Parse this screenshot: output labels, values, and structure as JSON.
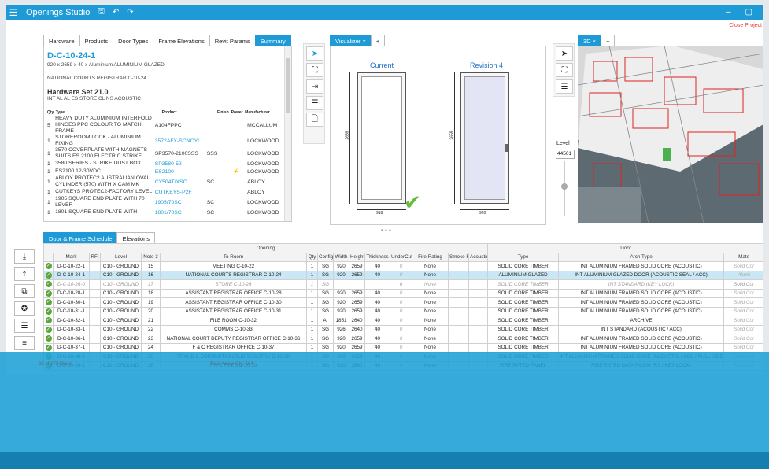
{
  "window": {
    "title": "Openings Studio",
    "close_project": "Close Project"
  },
  "tabs_top": [
    "Hardware",
    "Products",
    "Door Types",
    "Frame Elevations",
    "Revit Params",
    "Summary"
  ],
  "summary": {
    "door_id": "D-C-10-24-1",
    "spec": "920 x 2659 x 40 x Aluminium ALUMINIUM GLAZED",
    "location": "NATIONAL COURTS REGISTRAR C-10-24",
    "hardware_set": "Hardware Set 21.0",
    "hardware_sub": "INT AL AL ES STORE CL NS ACOUSTIC",
    "columns": [
      "Qty",
      "Type",
      "Product",
      "Finish",
      "Power",
      "Manufacturer"
    ],
    "rows": [
      {
        "qty": "5",
        "type": "HEAVY DUTY ALUMINIUM INTERFOLD HINGES PPC COLOUR TO MATCH FRAME",
        "product": "A104FPPC",
        "finish": "",
        "power": "",
        "mfr": "MCCALLUM"
      },
      {
        "qty": "1",
        "type": "STOREROOM LOCK - ALUMINIUM FIXING",
        "product": "3572AFX-SCNCYL",
        "finish": "",
        "power": "",
        "mfr": "LOCKWOOD"
      },
      {
        "qty": "1",
        "type": "3570 COVERPLATE WITH MAGNETS SUITS ES 2100 ELECTRIC STRIKE",
        "product": "SP3570-2100SSS",
        "finish": "SSS",
        "power": "",
        "mfr": "LOCKWOOD"
      },
      {
        "qty": "1",
        "type": "3580 SERIES - STRIKE DUST BOX",
        "product": "SP3580-52",
        "finish": "",
        "power": "",
        "mfr": "LOCKWOOD"
      },
      {
        "qty": "1",
        "type": "ES2100 12-30VDC",
        "product": "ES2100",
        "finish": "",
        "power": "⚡",
        "mfr": "LOCKWOOD"
      },
      {
        "qty": "1",
        "type": "ABLOY PROTEC2 AUSTRALIAN OVAL CYLINDER (570) WITH X CAM MK",
        "product": "CY504T/XSC",
        "finish": "SC",
        "power": "",
        "mfr": "ABLOY"
      },
      {
        "qty": "1",
        "type": "CUTKEYS PROTEC2-FACTORY LEVEL",
        "product": "CUTKEYS-P2F",
        "finish": "",
        "power": "",
        "mfr": "ABLOY"
      },
      {
        "qty": "1",
        "type": "1905 SQUARE END PLATE WITH 70 LEVER",
        "product": "1905/70SC",
        "finish": "SC",
        "power": "",
        "mfr": "LOCKWOOD"
      },
      {
        "qty": "1",
        "type": "1801 SQUARE END PLATE WITH",
        "product": "1801/70SC",
        "finish": "SC",
        "power": "",
        "mfr": "LOCKWOOD"
      }
    ]
  },
  "visualizer": {
    "tab": "Visualizer",
    "current": "Current",
    "revision": "Revision 4",
    "dim_h1": "2659",
    "dim_h2": "2659",
    "dim_w1": "918",
    "dim_w2": "920"
  },
  "view3d": {
    "tab": "3D",
    "level_label": "Level",
    "level_value": "44501"
  },
  "tabs_bottom": [
    "Door & Frame Schedule",
    "Elevations"
  ],
  "schedule": {
    "group_opening": "Opening",
    "group_door": "Door",
    "headers": [
      "Mark",
      "RFI",
      "Level",
      "Note 3",
      "To Room",
      "Qty",
      "Config",
      "Width",
      "Height",
      "Thickness",
      "UnderCut",
      "Fire Rating",
      "Smoke Rating",
      "Acoustic Rating",
      "Type",
      "Arch Type",
      "Mate"
    ],
    "rows": [
      {
        "mark": "D-C-10-22-1",
        "level": "C10 - GROUND",
        "note": "15",
        "room": "MEETING C-10-22",
        "qty": "1",
        "config": "SG",
        "width": "920",
        "height": "2659",
        "thick": "40",
        "uc": "0",
        "fire": "None",
        "type": "SOLID CORE TIMBER",
        "arch": "INT ALUMINIUM FRAMED SOLID CORE (ACOUSTIC)",
        "mat": "Solid Cor",
        "state": ""
      },
      {
        "mark": "D-C-10-24-1",
        "level": "C10 - GROUND",
        "note": "16",
        "room": "NATIONAL COURTS REGISTRAR C-10-24",
        "qty": "1",
        "config": "SG",
        "width": "920",
        "height": "2659",
        "thick": "40",
        "uc": "0",
        "fire": "None",
        "type": "ALUMINIUM GLAZED",
        "arch": "INT ALUMINIUM GLAZED DOOR (ACOUSTIC SEAL / ACC)",
        "mat": "Alumi",
        "state": "sel"
      },
      {
        "mark": "D-C-10-26-0",
        "level": "C10 - GROUND",
        "note": "17",
        "room": "STORE C-10-26",
        "qty": "1",
        "config": "SG",
        "width": "",
        "height": "",
        "thick": "",
        "uc": "0",
        "fire": "None",
        "type": "SOLID CORE TIMBER",
        "arch": "INT STANDARD (KEY LOCK)",
        "mat": "Solid Cor",
        "state": "dis"
      },
      {
        "mark": "D-C-10-28-1",
        "level": "C10 - GROUND",
        "note": "18",
        "room": "ASSISTANT REGISTRAR OFFICE C-10-28",
        "qty": "1",
        "config": "SG",
        "width": "920",
        "height": "2659",
        "thick": "40",
        "uc": "0",
        "fire": "None",
        "type": "SOLID CORE TIMBER",
        "arch": "INT ALUMINIUM FRAMED SOLID CORE (ACOUSTIC)",
        "mat": "Solid Cor",
        "state": ""
      },
      {
        "mark": "D-C-10-30-1",
        "level": "C10 - GROUND",
        "note": "19",
        "room": "ASSISTANT REGISTRAR OFFICE C-10-30",
        "qty": "1",
        "config": "SG",
        "width": "920",
        "height": "2659",
        "thick": "40",
        "uc": "0",
        "fire": "None",
        "type": "SOLID CORE TIMBER",
        "arch": "INT ALUMINIUM FRAMED SOLID CORE (ACOUSTIC)",
        "mat": "Solid Cor",
        "state": ""
      },
      {
        "mark": "D-C-10-31-1",
        "level": "C10 - GROUND",
        "note": "20",
        "room": "ASSISTANT REGISTRAR OFFICE C-10-31",
        "qty": "1",
        "config": "SG",
        "width": "920",
        "height": "2659",
        "thick": "40",
        "uc": "0",
        "fire": "None",
        "type": "SOLID CORE TIMBER",
        "arch": "INT ALUMINIUM FRAMED SOLID CORE (ACOUSTIC)",
        "mat": "Solid Cor",
        "state": ""
      },
      {
        "mark": "D-C-10-32-1",
        "level": "C10 - GROUND",
        "note": "21",
        "room": "FILE ROOM C-10-32",
        "qty": "1",
        "config": "AI",
        "width": "1851",
        "height": "2640",
        "thick": "40",
        "uc": "0",
        "fire": "None",
        "type": "SOLID CORE TIMBER",
        "arch": "ARCHIVE",
        "mat": "Solid Cor",
        "state": ""
      },
      {
        "mark": "D-C-10-33-1",
        "level": "C10 - GROUND",
        "note": "22",
        "room": "COMMS C-10-33",
        "qty": "1",
        "config": "SG",
        "width": "926",
        "height": "2640",
        "thick": "40",
        "uc": "0",
        "fire": "None",
        "type": "SOLID CORE TIMBER",
        "arch": "INT STANDARD (ACOUSTIC / ACC)",
        "mat": "Solid Cor",
        "state": ""
      },
      {
        "mark": "D-C-10-36-1",
        "level": "C10 - GROUND",
        "note": "23",
        "room": "NATIONAL COURT DEPUTY REGISTRAR OFFICE C-10-36",
        "qty": "1",
        "config": "SG",
        "width": "920",
        "height": "2659",
        "thick": "40",
        "uc": "0",
        "fire": "None",
        "type": "SOLID CORE TIMBER",
        "arch": "INT ALUMINIUM FRAMED SOLID CORE (ACOUSTIC)",
        "mat": "Solid Cor",
        "state": ""
      },
      {
        "mark": "D-C-10-37-1",
        "level": "C10 - GROUND",
        "note": "24",
        "room": "F & C REGISTRAR OFFICE C-10-37",
        "qty": "1",
        "config": "SG",
        "width": "920",
        "height": "2659",
        "thick": "40",
        "uc": "0",
        "fire": "None",
        "type": "SOLID CORE TIMBER",
        "arch": "INT ALUMINIUM FRAMED SOLID CORE (ACOUSTIC)",
        "mat": "Solid Cor",
        "state": ""
      },
      {
        "mark": "D-C-10-38-1",
        "level": "C10 - GROUND",
        "note": "25",
        "room": "FRAUD & CORRUPTION SUBREGISTRY C-10-38",
        "qty": "1",
        "config": "SG",
        "width": "920",
        "height": "2659",
        "thick": "40",
        "uc": "0",
        "fire": "None",
        "type": "SOLID CORE TIMBER",
        "arch": "INT ALUMINIUM FRAMED SOLID CORE (ACOUSTIC / ACC / PULL SIDE DC)",
        "mat": "Solid Cor",
        "state": ""
      },
      {
        "mark": "D-C-10-39-1",
        "level": "C10 - GROUND",
        "note": "26",
        "room": "F & C FILES C-10-39",
        "qty": "1",
        "config": "SG",
        "width": "920",
        "height": "2640",
        "thick": "40",
        "uc": "0",
        "fire": "None",
        "type": "FIRE RATED PANEL",
        "arch": "FIRE RATED DATA ROOM (RS / KEY LOCK)",
        "mat": "Solid Cor",
        "state": ""
      }
    ]
  },
  "footer": {
    "count": "23 of 172 Marks",
    "total": "Total Active Qty: 164"
  }
}
